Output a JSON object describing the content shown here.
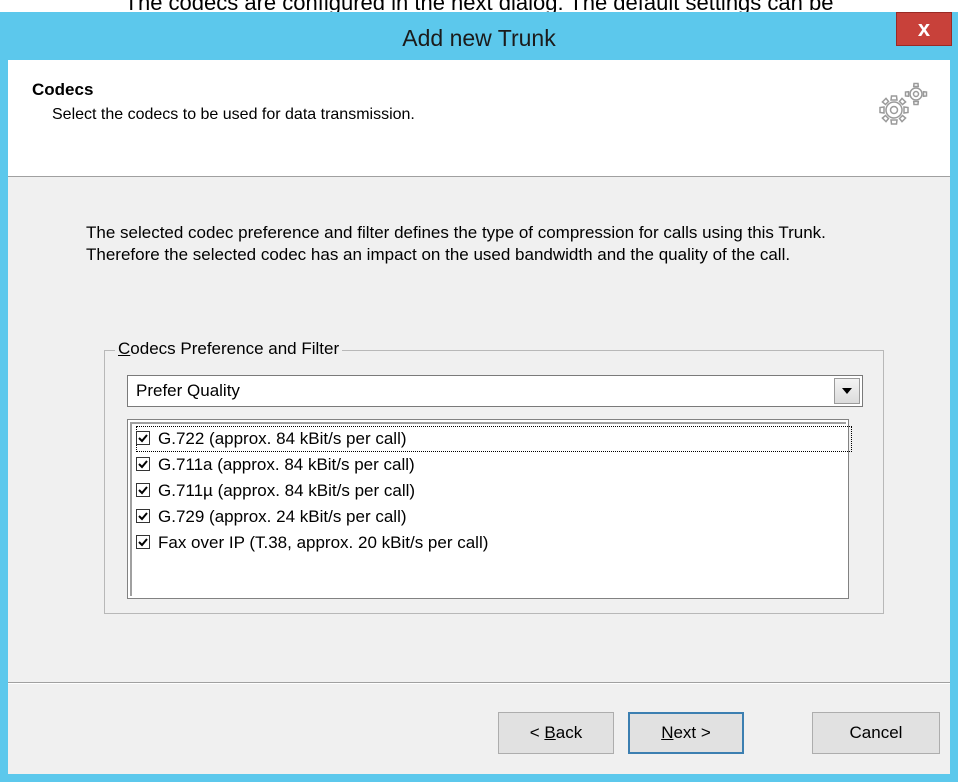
{
  "background": {
    "text": "The codecs are configured in the next dialog. The default settings can be"
  },
  "window": {
    "title": "Add new Trunk",
    "close_label": "x"
  },
  "header": {
    "title": "Codecs",
    "subtitle": "Select the codecs to be used for data transmission.",
    "icon": "gears-icon"
  },
  "description": "The selected codec preference and filter defines the type of compression for calls using this Trunk. Therefore the selected codec has an impact on the used bandwidth and the quality of the call.",
  "group": {
    "legend_mnemonic": "C",
    "legend_rest": "odecs Preference and Filter",
    "selected_preference": "Prefer Quality",
    "codecs": [
      {
        "label": "G.722 (approx. 84 kBit/s per call)",
        "checked": true
      },
      {
        "label": "G.711a (approx. 84 kBit/s per call)",
        "checked": true
      },
      {
        "label": "G.711µ (approx. 84 kBit/s per call)",
        "checked": true
      },
      {
        "label": "G.729 (approx. 24 kBit/s per call)",
        "checked": true
      },
      {
        "label": "Fax over IP (T.38, approx. 20 kBit/s per call)",
        "checked": true
      }
    ]
  },
  "buttons": {
    "back_prefix": "< ",
    "back_mnemonic": "B",
    "back_rest": "ack",
    "next_mnemonic": "N",
    "next_rest": "ext >",
    "cancel": "Cancel"
  },
  "colors": {
    "titlebar": "#5cc8ec",
    "close_button": "#c8413a",
    "dialog_body": "#f0f0f0"
  }
}
